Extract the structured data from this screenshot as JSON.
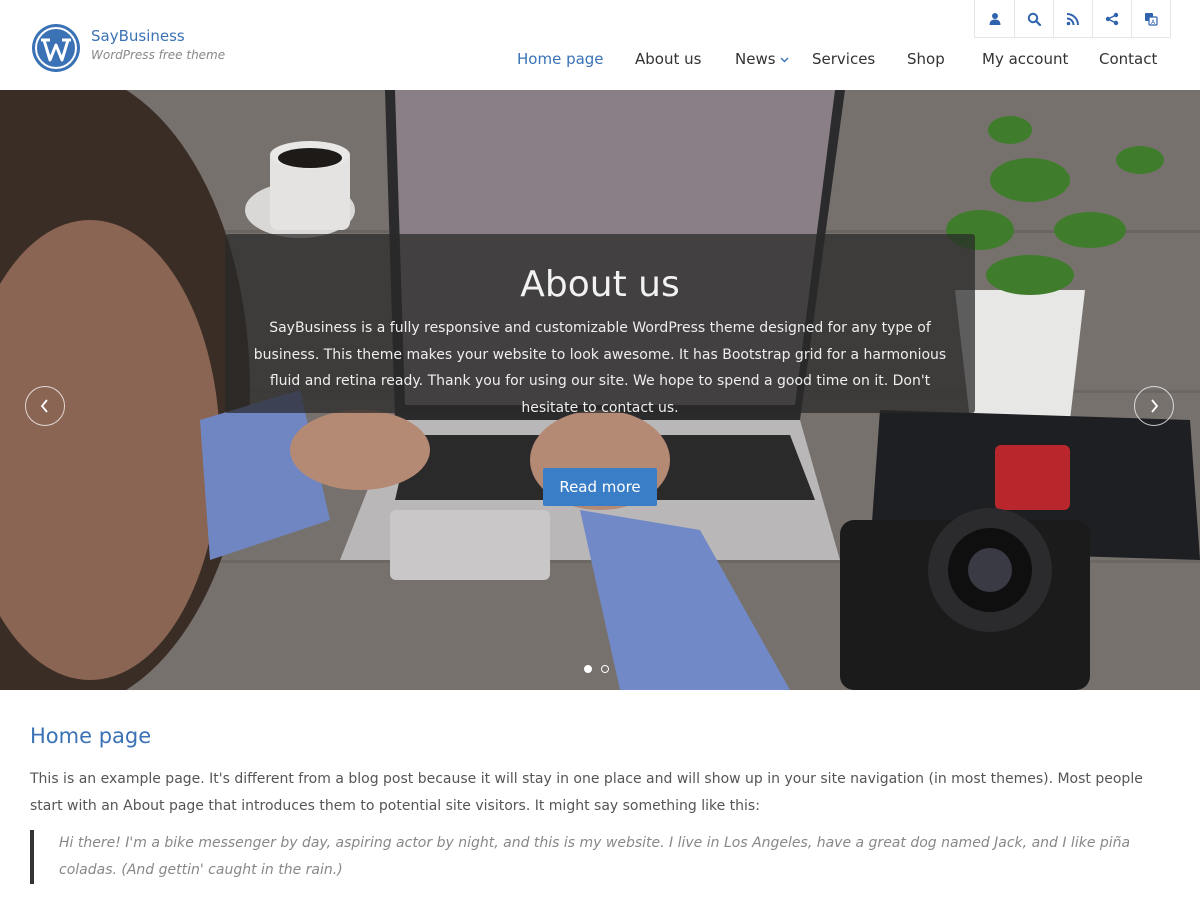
{
  "site": {
    "title": "SayBusiness",
    "tagline": "WordPress free theme"
  },
  "icons": [
    "user-icon",
    "search-icon",
    "rss-icon",
    "share-icon",
    "translate-icon"
  ],
  "nav": {
    "items": [
      {
        "label": "Home page",
        "active": true
      },
      {
        "label": "About us"
      },
      {
        "label": "News",
        "has_dropdown": true
      },
      {
        "label": "Services"
      },
      {
        "label": "Shop"
      },
      {
        "label": "My account"
      },
      {
        "label": "Contact"
      }
    ]
  },
  "slider": {
    "heading": "About us",
    "text": "SayBusiness is a fully responsive and customizable WordPress theme designed for any type of business. This theme makes your website to look awesome. It has Bootstrap grid for a harmonious fluid and retina ready. Thank you for using our site. We hope to spend a good time on it. Don't hesitate to contact us.",
    "button_label": "Read more",
    "slides": 2,
    "active_slide": 1
  },
  "page": {
    "title": "Home page",
    "intro": "This is an example page. It's different from a blog post because it will stay in one place and will show up in your site navigation (in most themes). Most people start with an About page that introduces them to potential site visitors. It might say something like this:",
    "quote": "Hi there! I'm a bike messenger by day, aspiring actor by night, and this is my website. I live in Los Angeles, have a great dog named Jack, and I like piña coladas. (And gettin' caught in the rain.)"
  },
  "colors": {
    "accent": "#3a72b5",
    "button": "#3a7ec8"
  }
}
